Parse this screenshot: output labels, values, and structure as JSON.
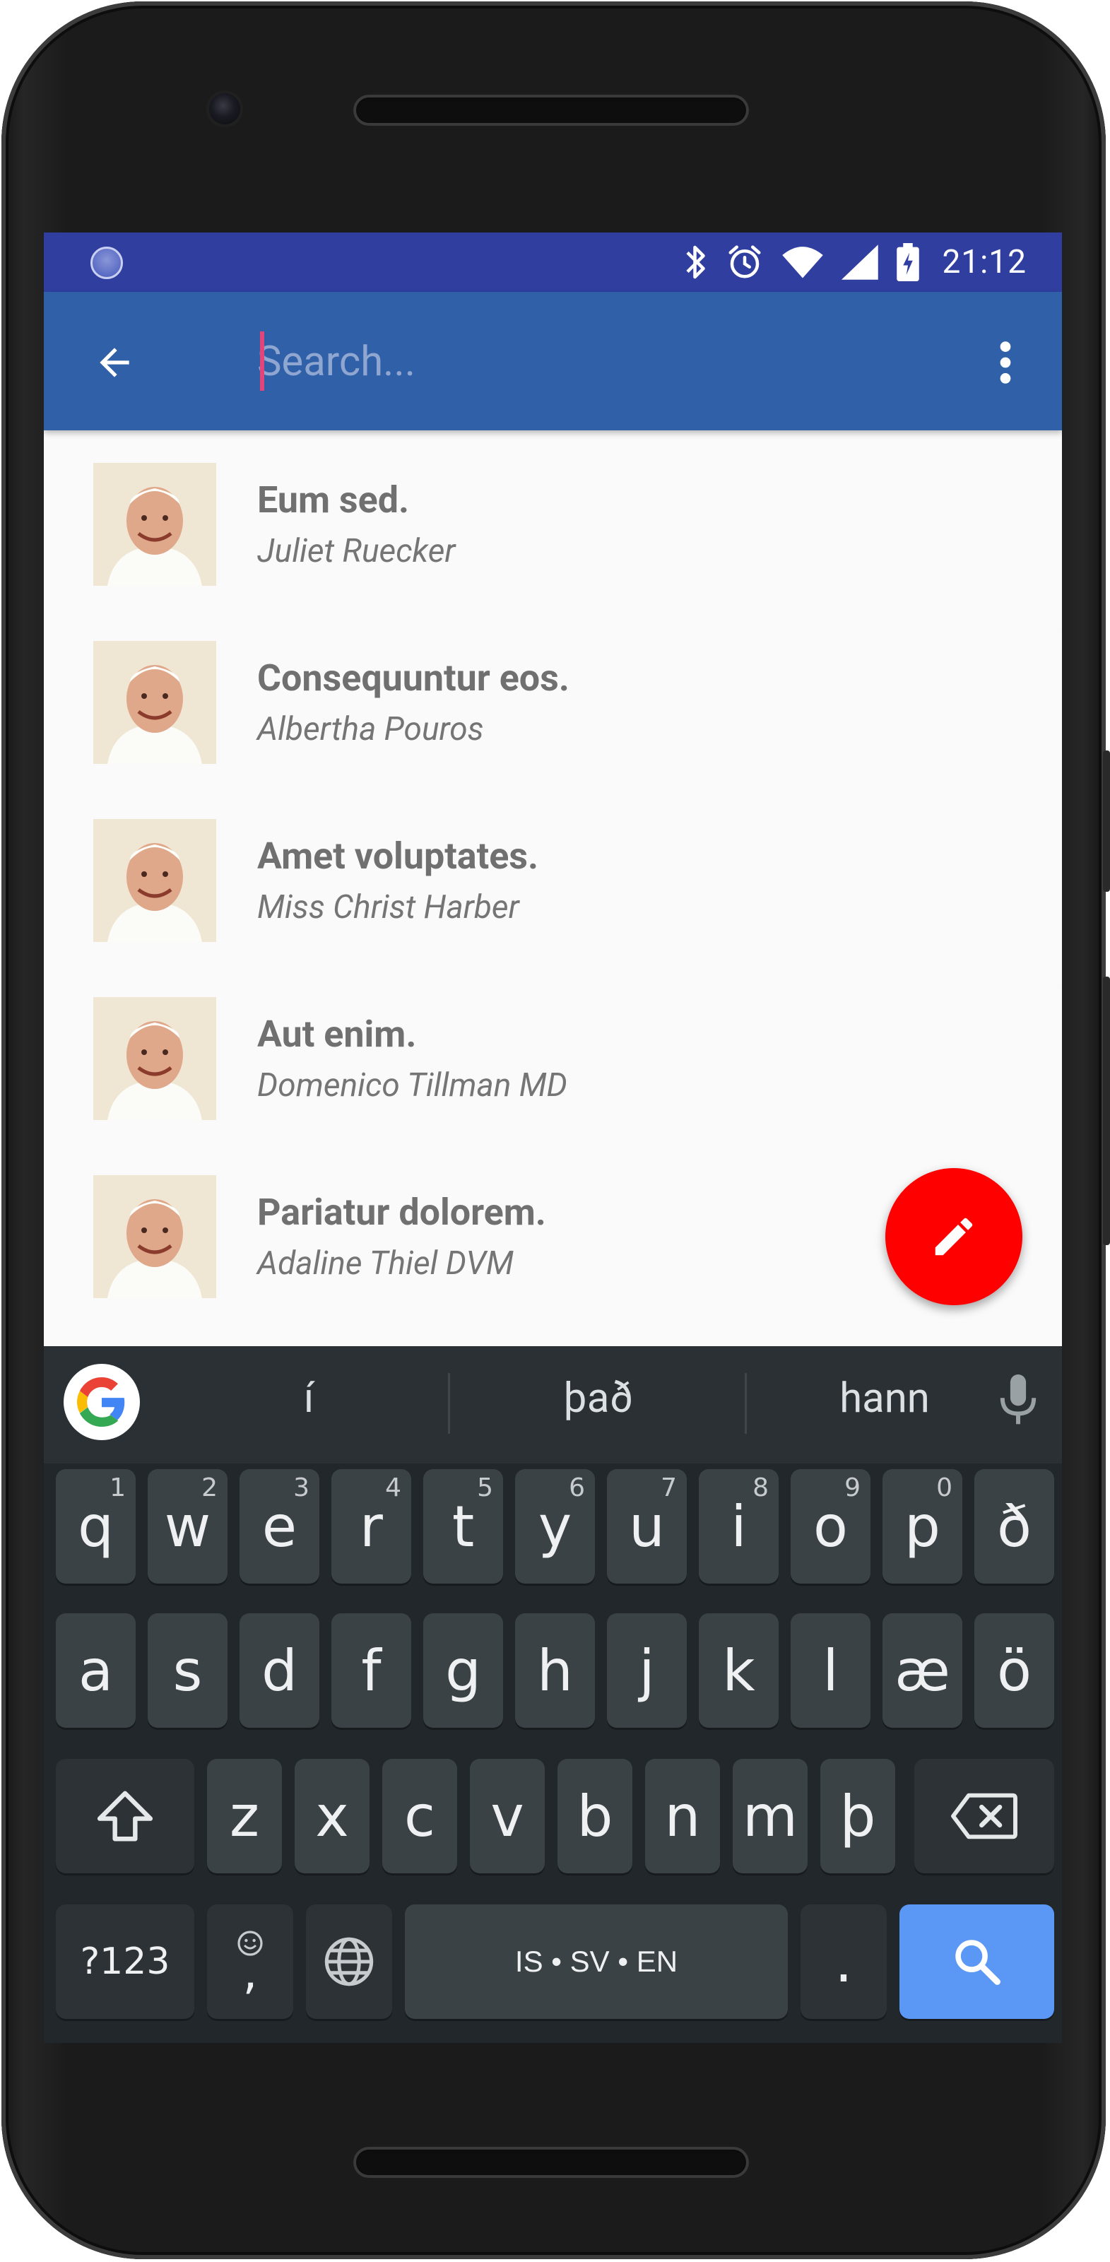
{
  "status_bar": {
    "time": "21:12",
    "icons": [
      "bluetooth-icon",
      "alarm-icon",
      "wifi-icon",
      "signal-icon",
      "battery-charging-icon"
    ]
  },
  "app_bar": {
    "search_placeholder": "Search...",
    "search_value": "",
    "back_icon": "arrow-back-icon",
    "menu_icon": "more-vert-icon"
  },
  "list": {
    "items": [
      {
        "title": "Eum sed.",
        "subtitle": "Juliet Ruecker"
      },
      {
        "title": "Consequuntur eos.",
        "subtitle": "Albertha Pouros"
      },
      {
        "title": "Amet voluptates.",
        "subtitle": "Miss Christ Harber"
      },
      {
        "title": "Aut enim.",
        "subtitle": "Domenico Tillman MD"
      },
      {
        "title": "Pariatur dolorem.",
        "subtitle": "Adaline Thiel DVM"
      }
    ]
  },
  "fab": {
    "icon": "edit-pencil-icon",
    "color": "#ff0000"
  },
  "keyboard": {
    "suggestions": [
      "í",
      "það",
      "hann"
    ],
    "rows": [
      [
        {
          "k": "q",
          "h": "1"
        },
        {
          "k": "w",
          "h": "2"
        },
        {
          "k": "e",
          "h": "3"
        },
        {
          "k": "r",
          "h": "4"
        },
        {
          "k": "t",
          "h": "5"
        },
        {
          "k": "y",
          "h": "6"
        },
        {
          "k": "u",
          "h": "7"
        },
        {
          "k": "i",
          "h": "8"
        },
        {
          "k": "o",
          "h": "9"
        },
        {
          "k": "p",
          "h": "0"
        },
        {
          "k": "ð",
          "h": ""
        }
      ],
      [
        {
          "k": "a"
        },
        {
          "k": "s"
        },
        {
          "k": "d"
        },
        {
          "k": "f"
        },
        {
          "k": "g"
        },
        {
          "k": "h"
        },
        {
          "k": "j"
        },
        {
          "k": "k"
        },
        {
          "k": "l"
        },
        {
          "k": "æ"
        },
        {
          "k": "ö"
        }
      ],
      [
        {
          "k": "z"
        },
        {
          "k": "x"
        },
        {
          "k": "c"
        },
        {
          "k": "v"
        },
        {
          "k": "b"
        },
        {
          "k": "n"
        },
        {
          "k": "m"
        },
        {
          "k": "þ"
        }
      ]
    ],
    "symbols_key": "?123",
    "comma_key": ",",
    "space_key": "IS • SV • EN",
    "period_key": "."
  },
  "colors": {
    "status_bar": "#303f9f",
    "app_bar": "#3060a8",
    "fab": "#ff0000",
    "keyboard_bg": "#22272b",
    "search_key": "#5b97f4"
  }
}
